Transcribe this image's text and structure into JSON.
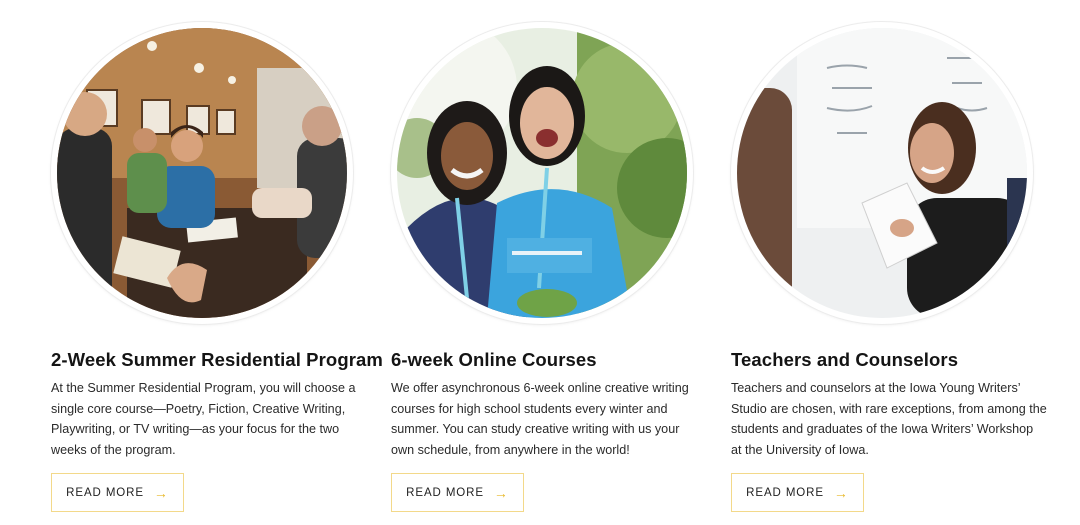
{
  "colors": {
    "accent": "#e8b92a",
    "button_border": "#f3d98a",
    "text": "#141414"
  },
  "cards": [
    {
      "title": "2-Week Summer Residential Program",
      "description_lines": [
        "At the Summer Residential Program, you will choose a",
        "single core course—Poetry, Fiction, Creative Writing,",
        "Playwriting, or TV writing—as your focus for the two",
        "weeks of the program."
      ],
      "button_label": "READ MORE",
      "button_icon": "arrow-right-icon",
      "image": "students-studying-at-table-photo"
    },
    {
      "title": "6-week Online Courses",
      "description_lines": [
        "We offer asynchronous 6-week online creative writing",
        "courses for high school students every winter and",
        "summer. You can study creative writing with us your",
        "own schedule, from anywhere in the world!"
      ],
      "button_label": "READ MORE",
      "button_icon": "arrow-right-icon",
      "image": "two-smiling-students-photo"
    },
    {
      "title": "Teachers and Counselors",
      "description_lines": [
        "Teachers and counselors at the Iowa Young Writers’",
        "Studio are chosen, with rare exceptions, from among the",
        "students and graduates of the Iowa Writers’ Workshop",
        "at the University of Iowa."
      ],
      "button_label": "READ MORE",
      "button_icon": "arrow-right-icon",
      "image": "teacher-laughing-at-whiteboard-photo"
    }
  ]
}
